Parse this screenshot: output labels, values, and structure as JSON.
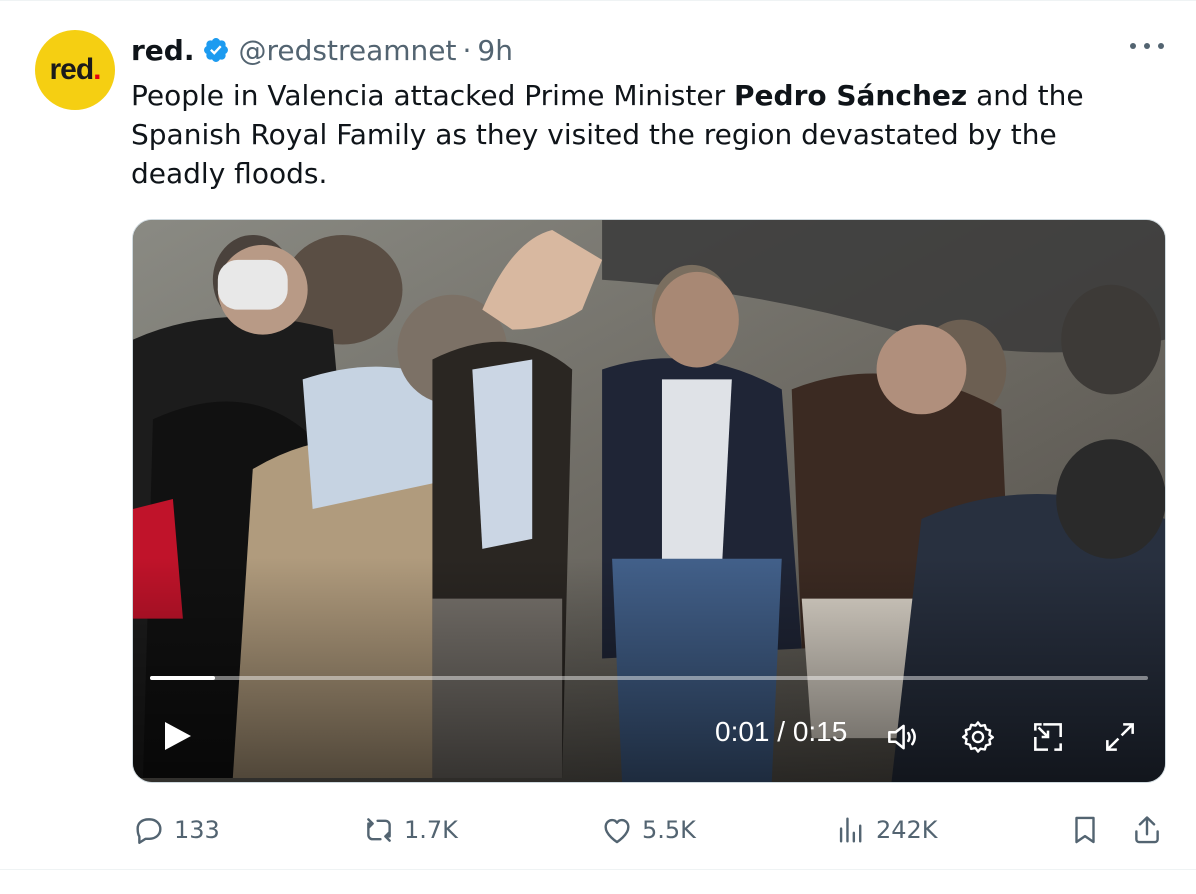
{
  "author": {
    "avatar_text": "red",
    "avatar_dot": ".",
    "name": "red.",
    "handle": "@redstreamnet",
    "separator": "·",
    "time": "9h",
    "avatar_color": "#f5cf12",
    "verified_color": "#1d9bf0"
  },
  "tweet": {
    "text_before": "People in Valencia attacked Prime Minister ",
    "text_bold": "Pedro Sánchez",
    "text_after": " and the Spanish Royal Family as they visited the region devastated by the deadly floods."
  },
  "video": {
    "timecode": "0:01 / 0:15",
    "progress": 0.065,
    "play_icon": "play-icon",
    "controls": [
      "volume-icon",
      "settings-icon",
      "dock-icon",
      "fullscreen-icon"
    ]
  },
  "actions": {
    "replies": "133",
    "reposts": "1.7K",
    "likes": "5.5K",
    "views": "242K"
  }
}
